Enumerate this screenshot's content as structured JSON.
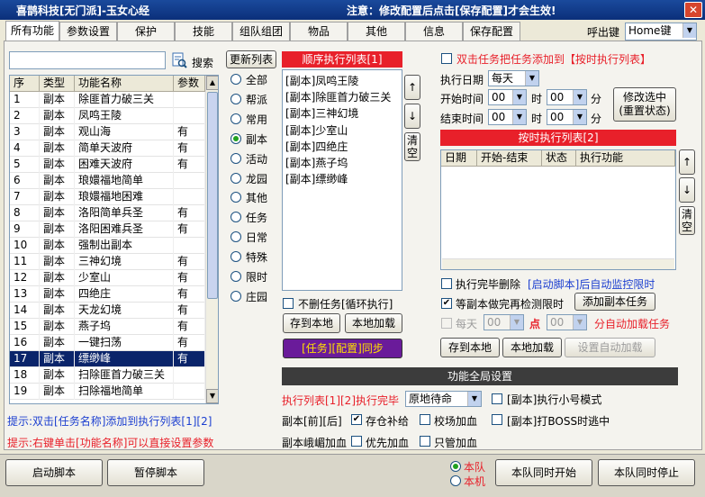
{
  "window": {
    "title": "喜鹊科技[无门派]-玉女心经",
    "notice": "注意：修改配置后点击[保存配置]才会生效!",
    "close": "✕"
  },
  "tabs": [
    "所有功能",
    "参数设置",
    "保护",
    "技能",
    "组队组团",
    "物品",
    "其他",
    "信息",
    "保存配置"
  ],
  "hotkey": {
    "label": "呼出键",
    "value": "Home键"
  },
  "search": {
    "value": "",
    "button": "搜索"
  },
  "refresh_button": "更新列表",
  "func_table": {
    "headers": [
      "序",
      "类型",
      "功能名称",
      "参数"
    ],
    "rows": [
      [
        "1",
        "副本",
        "除匪首力破三关",
        ""
      ],
      [
        "2",
        "副本",
        "凤鸣王陵",
        ""
      ],
      [
        "3",
        "副本",
        "观山海",
        "有"
      ],
      [
        "4",
        "副本",
        "简单天波府",
        "有"
      ],
      [
        "5",
        "副本",
        "困难天波府",
        "有"
      ],
      [
        "6",
        "副本",
        "琅嬛福地简单",
        ""
      ],
      [
        "7",
        "副本",
        "琅嬛福地困难",
        ""
      ],
      [
        "8",
        "副本",
        "洛阳简单兵圣",
        "有"
      ],
      [
        "9",
        "副本",
        "洛阳困难兵圣",
        "有"
      ],
      [
        "10",
        "副本",
        "强制出副本",
        ""
      ],
      [
        "11",
        "副本",
        "三神幻境",
        "有"
      ],
      [
        "12",
        "副本",
        "少室山",
        "有"
      ],
      [
        "13",
        "副本",
        "四绝庄",
        "有"
      ],
      [
        "14",
        "副本",
        "天龙幻境",
        "有"
      ],
      [
        "15",
        "副本",
        "燕子坞",
        "有"
      ],
      [
        "16",
        "副本",
        "一键扫荡",
        "有"
      ],
      [
        "17",
        "副本",
        "缥缈峰",
        "有"
      ],
      [
        "18",
        "副本",
        "扫除匪首力破三关",
        ""
      ],
      [
        "19",
        "副本",
        "扫除福地简单",
        ""
      ]
    ]
  },
  "categories": [
    "全部",
    "帮派",
    "常用",
    "副本",
    "活动",
    "龙园",
    "其他",
    "任务",
    "日常",
    "特殊",
    "限时",
    "庄园"
  ],
  "seq_list": {
    "title": "顺序执行列表[1]",
    "items": [
      "[副本]凤鸣王陵",
      "[副本]除匪首力破三关",
      "[副本]三神幻境",
      "[副本]少室山",
      "[副本]四绝庄",
      "[副本]燕子坞",
      "[副本]缥缈峰"
    ]
  },
  "arrows": {
    "up": "↑",
    "down": "↓",
    "clear": "清空"
  },
  "seq_controls": {
    "loop_label": "不删任务[循环执行]",
    "save": "存到本地",
    "load": "本地加载",
    "sync": "[任务][配置]同步"
  },
  "timed": {
    "dbl_click_label": "双击任务把任务添加到【按时执行列表】",
    "date_label": "执行日期",
    "date_value": "每天",
    "start_label": "开始时间",
    "end_label": "结束时间",
    "hour": "00",
    "minute": "00",
    "hour_unit": "时",
    "minute_unit": "分",
    "modify_button": "修改选中(重置状态)",
    "list_title": "按时执行列表[2]",
    "headers": [
      "日期",
      "开始-结束",
      "状态",
      "执行功能"
    ],
    "del_after_label": "执行完毕删除",
    "monitor_label": "[启动脚本]后自动监控限时",
    "wait_label": "等副本做完再检测限时",
    "add_button": "添加副本任务",
    "every_label": "每天",
    "every_value": "00",
    "point_label": "点",
    "min_value": "00",
    "auto_label": "分自动加载任务",
    "save": "存到本地",
    "load": "本地加载",
    "auto_set": "设置自动加载"
  },
  "global": {
    "title": "功能全局设置",
    "finish_label": "执行列表[1][2]执行完毕",
    "finish_value": "原地待命",
    "small_mode": "[副本]执行小号模式",
    "before_after": "副本[前][后]",
    "storage": "存仓补给",
    "campus": "校场加血",
    "boss_timeout": "[副本]打BOSS时逃中",
    "emei_label": "副本峨嵋加血",
    "priority": "优先加血",
    "only": "只管加血"
  },
  "hints": {
    "h1": "提示:双击[任务名称]添加到执行列表[1][2]",
    "h2": "提示:右键单击[功能名称]可以直接设置参数"
  },
  "footer": {
    "start": "启动脚本",
    "pause": "暂停脚本",
    "team": "本队",
    "local": "本机",
    "team_start": "本队同时开始",
    "team_stop": "本队同时停止"
  },
  "colors": {
    "red": "#e8202a",
    "blue": "#1c3fd0",
    "purple": "#6a1b9a",
    "sync_text": "#ffe000"
  }
}
